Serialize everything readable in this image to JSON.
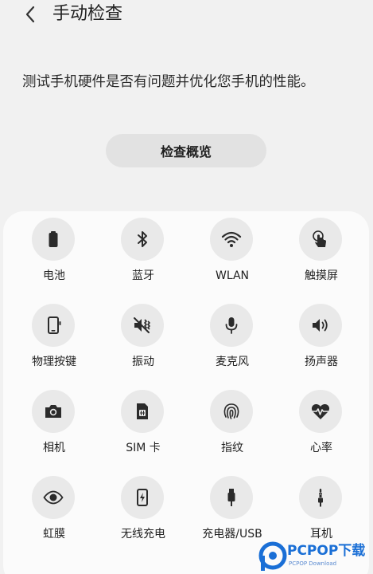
{
  "header": {
    "back_icon": "chevron-left-icon",
    "title": "手动检查"
  },
  "description": "测试手机硬件是否有问题并优化您手机的性能。",
  "overview_button": "检查概览",
  "items": [
    {
      "label": "电池",
      "icon": "battery-icon"
    },
    {
      "label": "蓝牙",
      "icon": "bluetooth-icon"
    },
    {
      "label": "WLAN",
      "icon": "wifi-icon"
    },
    {
      "label": "触摸屏",
      "icon": "touch-icon"
    },
    {
      "label": "物理按键",
      "icon": "phone-button-icon"
    },
    {
      "label": "振动",
      "icon": "vibration-icon"
    },
    {
      "label": "麦克风",
      "icon": "microphone-icon"
    },
    {
      "label": "扬声器",
      "icon": "speaker-icon"
    },
    {
      "label": "相机",
      "icon": "camera-icon"
    },
    {
      "label": "SIM 卡",
      "icon": "sim-card-icon"
    },
    {
      "label": "指纹",
      "icon": "fingerprint-icon"
    },
    {
      "label": "心率",
      "icon": "heart-rate-icon"
    },
    {
      "label": "虹膜",
      "icon": "eye-icon"
    },
    {
      "label": "无线充电",
      "icon": "wireless-charging-icon"
    },
    {
      "label": "充电器/USB",
      "icon": "usb-charger-icon"
    },
    {
      "label": "耳机",
      "icon": "earphone-jack-icon"
    }
  ],
  "watermark": {
    "main": "PCPOP下载",
    "sub": "PCPOP Download",
    "color": "#1a6fd6"
  }
}
